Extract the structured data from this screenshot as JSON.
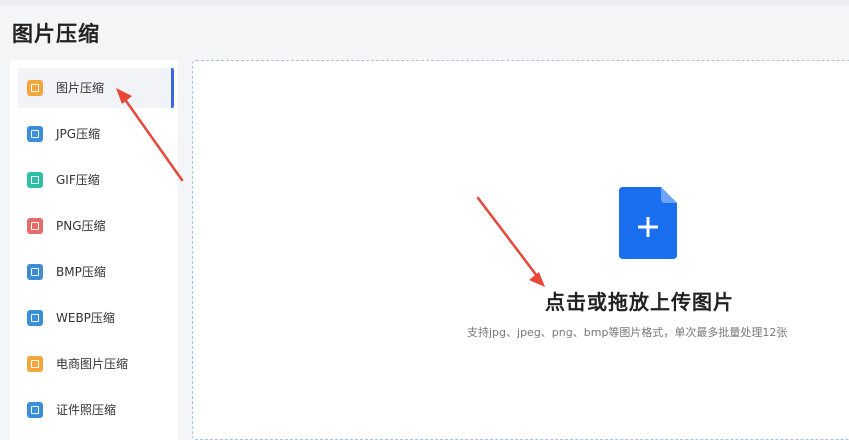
{
  "page": {
    "title": "图片压缩"
  },
  "sidebar": {
    "items": [
      {
        "label": "图片压缩",
        "icon": "image-compress-icon",
        "color": "#f3a63b",
        "active": true
      },
      {
        "label": "JPG压缩",
        "icon": "jpg-compress-icon",
        "color": "#3b8fd8"
      },
      {
        "label": "GIF压缩",
        "icon": "gif-compress-icon",
        "color": "#2fbfa6"
      },
      {
        "label": "PNG压缩",
        "icon": "png-compress-icon",
        "color": "#e86a6a"
      },
      {
        "label": "BMP压缩",
        "icon": "bmp-compress-icon",
        "color": "#3b8fd8"
      },
      {
        "label": "WEBP压缩",
        "icon": "webp-compress-icon",
        "color": "#3b8fd8"
      },
      {
        "label": "电商图片压缩",
        "icon": "ecommerce-compress-icon",
        "color": "#f3a63b"
      },
      {
        "label": "证件照压缩",
        "icon": "id-photo-compress-icon",
        "color": "#3b8fd8"
      }
    ]
  },
  "upload": {
    "title": "点击或拖放上传图片",
    "hint": "支持jpg、jpeg、png、bmp等图片格式，单次最多批量处理12张",
    "icon": "file-plus-icon",
    "icon_color": "#1a6ef0"
  },
  "colors": {
    "accent": "#3a68e0",
    "annotation_arrow": "#e8473a"
  }
}
